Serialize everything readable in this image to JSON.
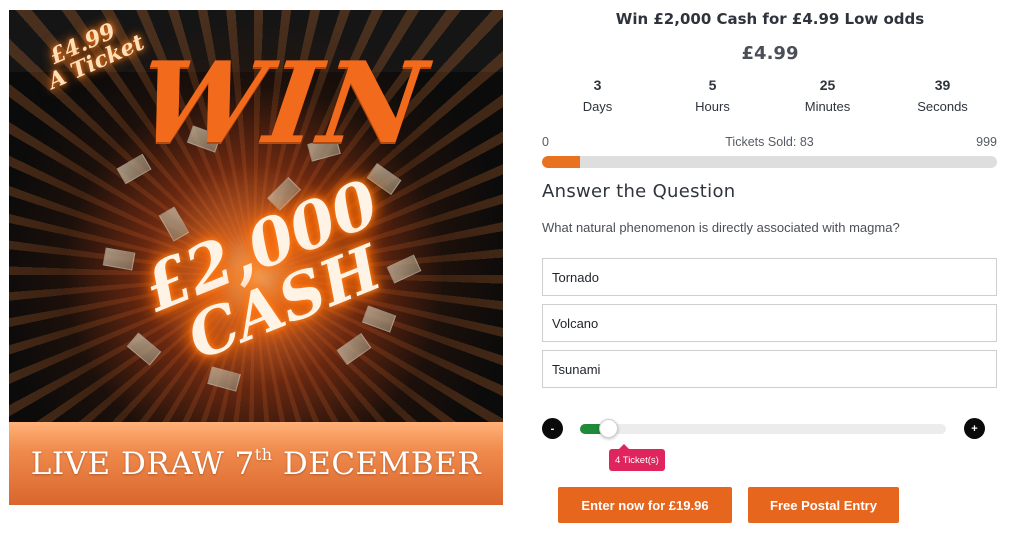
{
  "promo": {
    "price_line1": "£4.99",
    "price_line2": "A Ticket",
    "headline": "WIN",
    "amount": "£2,000",
    "cash": "CASH",
    "draw_prefix": "LIVE DRAW 7",
    "draw_sup": "th",
    "draw_suffix": " DECEMBER",
    "accent_color": "#f26a1b"
  },
  "competition": {
    "title": "Win £2,000 Cash for £4.99 Low odds",
    "price": "£4.99"
  },
  "countdown": [
    {
      "value": "3",
      "label": "Days"
    },
    {
      "value": "5",
      "label": "Hours"
    },
    {
      "value": "25",
      "label": "Minutes"
    },
    {
      "value": "39",
      "label": "Seconds"
    }
  ],
  "tickets": {
    "min_label": "0",
    "sold_label": "Tickets Sold: 83",
    "max_label": "999",
    "sold": 83,
    "max": 999
  },
  "question": {
    "heading": "Answer the Question",
    "text": "What natural phenomenon is directly associated with magma?",
    "answers": [
      "Tornado",
      "Volcano",
      "Tsunami"
    ]
  },
  "quantity": {
    "minus_label": "-",
    "plus_label": "+",
    "tooltip": "4 Ticket(s)",
    "fill_fraction": 0.077
  },
  "actions": {
    "enter_label": "Enter now for £19.96",
    "postal_label": "Free Postal Entry"
  },
  "colors": {
    "orange": "#e6661e",
    "slider_green": "#1f8a3a",
    "tooltip_pink": "#e0245e"
  }
}
